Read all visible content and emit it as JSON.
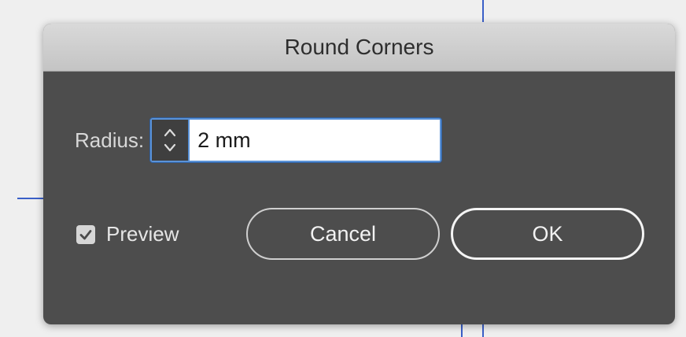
{
  "dialog": {
    "title": "Round Corners",
    "radius_label": "Radius:",
    "radius_value": "2 mm",
    "preview_label": "Preview",
    "preview_checked": true,
    "cancel_label": "Cancel",
    "ok_label": "OK"
  },
  "icons": {
    "stepper": "up-down-arrows-icon",
    "checkbox": "checkmark-icon"
  },
  "colors": {
    "dialog_bg": "#4d4d4d",
    "titlebar_bg": "#cccccc",
    "focus_ring": "#5a92d8",
    "guide_line": "#3a5fc8"
  }
}
